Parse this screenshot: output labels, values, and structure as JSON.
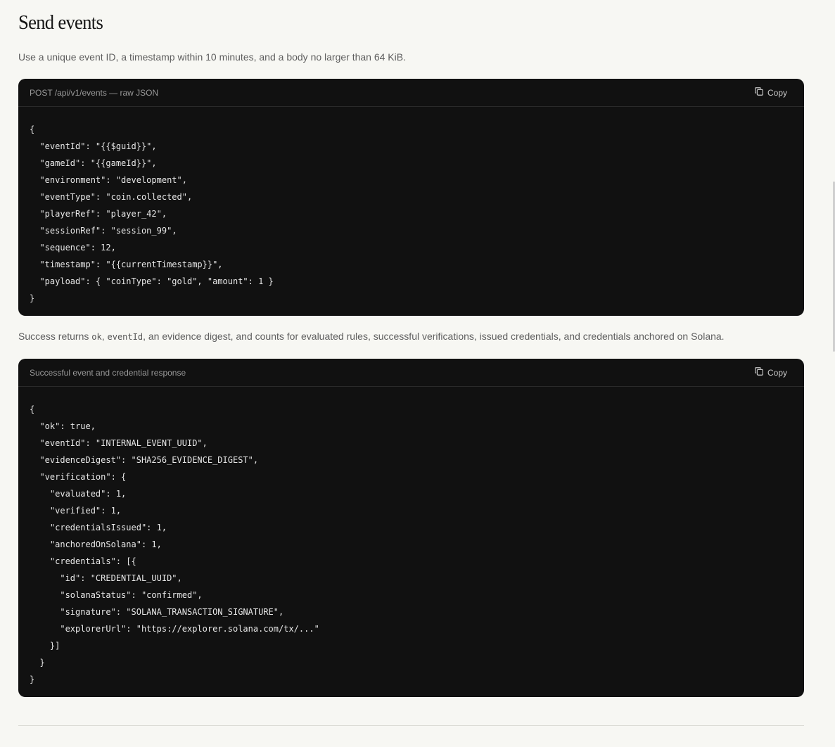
{
  "section": {
    "title": "Send events",
    "lede": "Use a unique event ID, a timestamp within 10 minutes, and a body no larger than 64 KiB."
  },
  "request_block": {
    "label": "POST /api/v1/events — raw JSON",
    "copy_label": "Copy",
    "copy_icon": "copy-icon",
    "code": "{\n  \"eventId\": \"{{$guid}}\",\n  \"gameId\": \"{{gameId}}\",\n  \"environment\": \"development\",\n  \"eventType\": \"coin.collected\",\n  \"playerRef\": \"player_42\",\n  \"sessionRef\": \"session_99\",\n  \"sequence\": 12,\n  \"timestamp\": \"{{currentTimestamp}}\",\n  \"payload\": { \"coinType\": \"gold\", \"amount\": 1 }\n}"
  },
  "success_note": {
    "prefix": "Success returns ",
    "code_ok": "ok",
    "sep": ", ",
    "code_eventid": "eventId",
    "suffix": ", an evidence digest, and counts for evaluated rules, successful verifications, issued credentials, and credentials anchored on Solana."
  },
  "response_block": {
    "label": "Successful event and credential response",
    "copy_label": "Copy",
    "copy_icon": "copy-icon",
    "code": "{\n  \"ok\": true,\n  \"eventId\": \"INTERNAL_EVENT_UUID\",\n  \"evidenceDigest\": \"SHA256_EVIDENCE_DIGEST\",\n  \"verification\": {\n    \"evaluated\": 1,\n    \"verified\": 1,\n    \"credentialsIssued\": 1,\n    \"anchoredOnSolana\": 1,\n    \"credentials\": [{\n      \"id\": \"CREDENTIAL_UUID\",\n      \"solanaStatus\": \"confirmed\",\n      \"signature\": \"SOLANA_TRANSACTION_SIGNATURE\",\n      \"explorerUrl\": \"https://explorer.solana.com/tx/...\"\n    }]\n  }\n}"
  },
  "colors": {
    "page_bg": "#f7f7f3",
    "code_bg": "#111111",
    "code_text": "#e8e8e8",
    "muted_text": "#5e5e5e"
  }
}
